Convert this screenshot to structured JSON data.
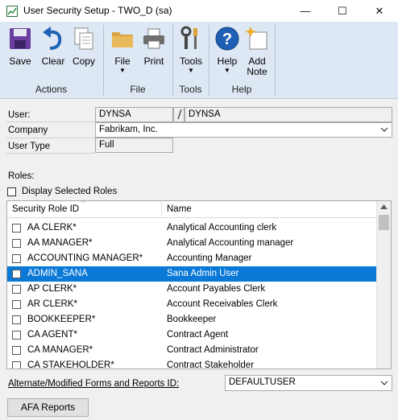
{
  "window": {
    "title": "User Security Setup  -  TWO_D (sa)",
    "minimize_glyph": "—",
    "maximize_glyph": "☐",
    "close_glyph": "✕"
  },
  "ribbon": {
    "buttons": {
      "save": "Save",
      "clear": "Clear",
      "copy": "Copy",
      "file": "File",
      "print": "Print",
      "tools": "Tools",
      "help": "Help",
      "add_note_line1": "Add",
      "add_note_line2": "Note"
    },
    "groups": {
      "actions": "Actions",
      "file": "File",
      "tools": "Tools",
      "help": "Help"
    },
    "dropdown_glyph": "▼"
  },
  "form": {
    "user_label": "User:",
    "user_id": "DYNSA",
    "user_name": "DYNSA",
    "company_label": "Company",
    "company_value": "Fabrikam, Inc.",
    "user_type_label": "User Type",
    "user_type_value": "Full",
    "roles_label": "Roles:",
    "display_selected_roles": "Display Selected Roles"
  },
  "grid": {
    "columns": [
      "Security Role ID",
      "Name"
    ],
    "sort_glyph": "^",
    "rows": [
      {
        "id": "AA CLERK*",
        "name": "Analytical Accounting clerk",
        "selected": false
      },
      {
        "id": "AA MANAGER*",
        "name": "Analytical Accounting manager",
        "selected": false
      },
      {
        "id": "ACCOUNTING MANAGER*",
        "name": "Accounting Manager",
        "selected": false
      },
      {
        "id": "ADMIN_SANA",
        "name": "Sana Admin User",
        "selected": true
      },
      {
        "id": "AP CLERK*",
        "name": "Account Payables Clerk",
        "selected": false
      },
      {
        "id": "AR CLERK*",
        "name": "Account Receivables Clerk",
        "selected": false
      },
      {
        "id": "BOOKKEEPER*",
        "name": "Bookkeeper",
        "selected": false
      },
      {
        "id": "CA AGENT*",
        "name": "Contract Agent",
        "selected": false
      },
      {
        "id": "CA MANAGER*",
        "name": "Contract Administrator",
        "selected": false
      },
      {
        "id": "CA STAKEHOLDER*",
        "name": "Contract Stakeholder",
        "selected": false
      }
    ]
  },
  "footer": {
    "alt_forms_label": "Alternate/Modified Forms and Reports ID:",
    "alt_forms_value": "DEFAULTUSER",
    "afa_button": "AFA Reports"
  },
  "colors": {
    "selection": "#0a78d7",
    "ribbon_bg": "#dde8f4"
  }
}
